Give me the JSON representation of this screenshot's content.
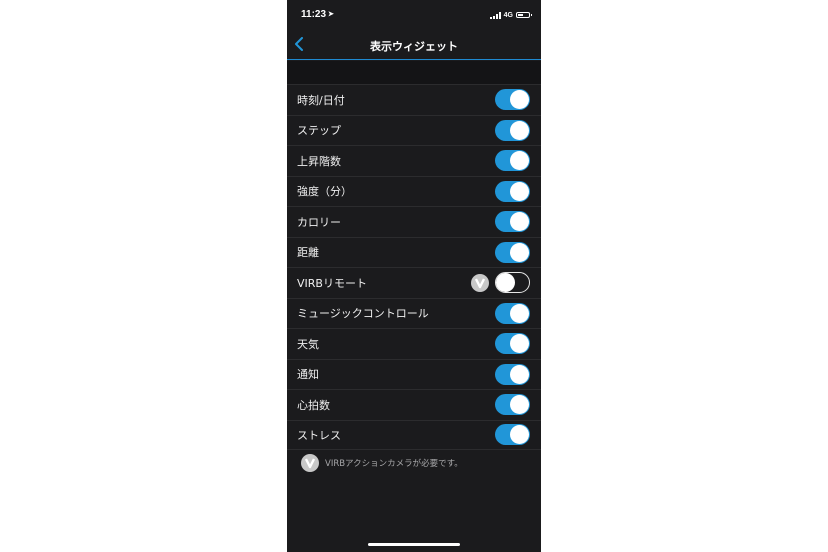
{
  "status_bar": {
    "time": "11:23",
    "network": "4G"
  },
  "nav": {
    "title": "表示ウィジェット"
  },
  "widgets": [
    {
      "label": "時刻/日付",
      "enabled": true,
      "requires_virb": false
    },
    {
      "label": "ステップ",
      "enabled": true,
      "requires_virb": false
    },
    {
      "label": "上昇階数",
      "enabled": true,
      "requires_virb": false
    },
    {
      "label": "強度（分）",
      "enabled": true,
      "requires_virb": false
    },
    {
      "label": "カロリー",
      "enabled": true,
      "requires_virb": false
    },
    {
      "label": "距離",
      "enabled": true,
      "requires_virb": false
    },
    {
      "label": "VIRBリモート",
      "enabled": false,
      "requires_virb": true
    },
    {
      "label": "ミュージックコントロール",
      "enabled": true,
      "requires_virb": false
    },
    {
      "label": "天気",
      "enabled": true,
      "requires_virb": false
    },
    {
      "label": "通知",
      "enabled": true,
      "requires_virb": false
    },
    {
      "label": "心拍数",
      "enabled": true,
      "requires_virb": false
    },
    {
      "label": "ストレス",
      "enabled": true,
      "requires_virb": false
    }
  ],
  "footnote": {
    "text": "VIRBアクションカメラが必要です。"
  },
  "colors": {
    "accent": "#2196d8",
    "background": "#1b1b1d",
    "divider": "#2c2c2e"
  },
  "icons": {
    "back": "chevron-left-icon",
    "virb": "virb-v-icon"
  }
}
